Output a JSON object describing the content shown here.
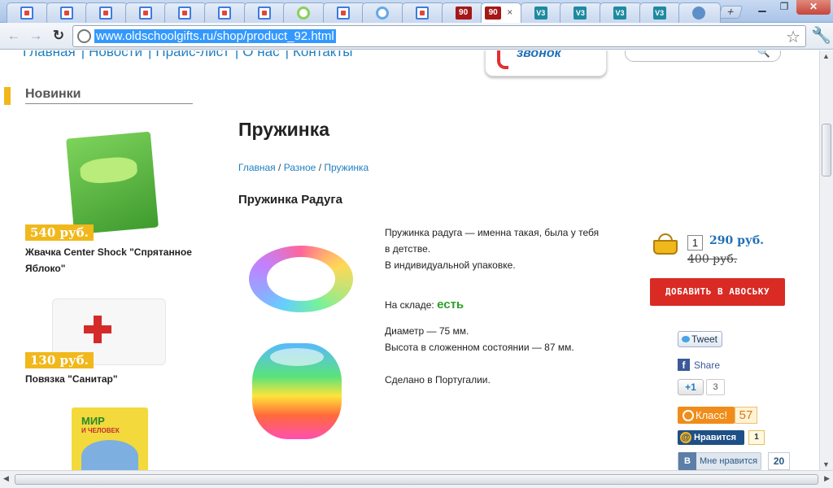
{
  "browser": {
    "tabs": [
      {
        "icon": "google-icon",
        "active": false
      },
      {
        "icon": "google-icon",
        "active": false
      },
      {
        "icon": "google-icon",
        "active": false
      },
      {
        "icon": "google-icon",
        "active": false
      },
      {
        "icon": "google-icon",
        "active": false
      },
      {
        "icon": "google-icon",
        "active": false
      },
      {
        "icon": "google-icon",
        "active": false
      },
      {
        "icon": "ring-icon",
        "active": false
      },
      {
        "icon": "google-icon",
        "active": false
      },
      {
        "icon": "blue-ring-icon",
        "active": false
      },
      {
        "icon": "google-icon",
        "active": false
      },
      {
        "icon": "site-90-icon",
        "label": "90",
        "active": false
      },
      {
        "icon": "site-90-icon",
        "label": "90",
        "active": true
      },
      {
        "icon": "v3-icon",
        "label": "V3",
        "active": false
      },
      {
        "icon": "v3-icon",
        "label": "V3",
        "active": false
      },
      {
        "icon": "v3-icon",
        "label": "V3",
        "active": false
      },
      {
        "icon": "v3-icon",
        "label": "V3",
        "active": false
      },
      {
        "icon": "swirl-icon",
        "active": false
      }
    ],
    "close_tab_glyph": "×",
    "new_tab_glyph": "+",
    "url": "www.oldschoolgifts.ru/shop/product_92.html"
  },
  "site": {
    "menu": [
      "Главная",
      "Новости",
      "Прайс-лист",
      "О нас",
      "Контакты"
    ],
    "menu_separator": "|",
    "callback_label": "звонок",
    "search_placeholder": ""
  },
  "sidebar": {
    "title": "Новинки",
    "items": [
      {
        "price": "540 руб.",
        "name": "Жвачка Center Shock \"Спрятанное Яблоко\""
      },
      {
        "price": "130 руб.",
        "name": "Повязка \"Санитар\""
      },
      {
        "cover_title": "МИР",
        "cover_subtitle": "И ЧЕЛОВЕК"
      }
    ]
  },
  "product": {
    "page_title": "Пружинка",
    "breadcrumb": [
      "Главная",
      "Разное",
      "Пружинка"
    ],
    "breadcrumb_separator": "/",
    "name": "Пружинка Радуга",
    "desc_line1": "Пружинка радуга — именна такая, была у тебя",
    "desc_line2": "в детстве.",
    "desc_line3": "В индивидуальной упаковке.",
    "stock_label": "На складе:",
    "stock_value": "есть",
    "diameter": "Диаметр — 75 мм.",
    "height": "Высота в сложенном состоянии — 87 мм.",
    "origin": "Сделано в Португалии.",
    "quantity": "1",
    "price": "290 руб.",
    "old_price": "400 руб.",
    "add_button": "ДОБАВИТЬ В АВОСЬКУ"
  },
  "social": {
    "tweet": "Tweet",
    "fb_share": "Share",
    "gplus": "+1",
    "gplus_count": "3",
    "ok_label": "Класс!",
    "ok_count": "57",
    "mail_label": "Нравится",
    "mail_count": "1",
    "vk_label": "Мне нравится",
    "vk_count": "20"
  }
}
